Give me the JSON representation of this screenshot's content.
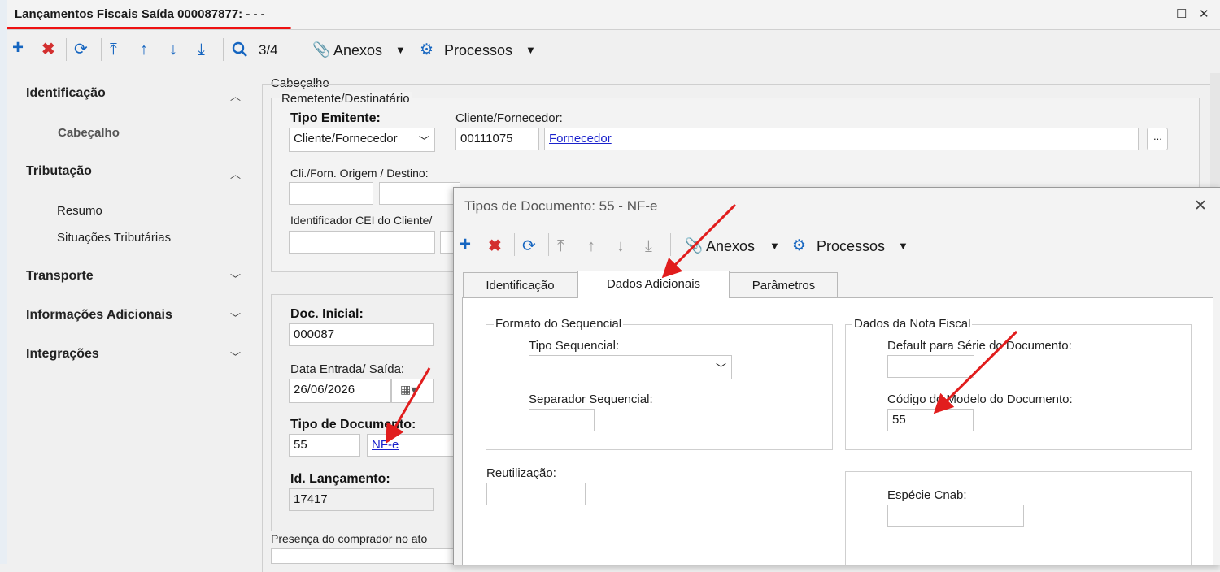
{
  "window": {
    "title": "Lançamentos Fiscais Saída 000087877:",
    "title_suffix": " - - -",
    "maximize_glyph": "☐",
    "close_glyph": "✕"
  },
  "toolbar": {
    "record_position": "3/4",
    "anexos_label": "Anexos",
    "processos_label": "Processos"
  },
  "sidebar": {
    "sections": [
      {
        "label": "Identificação",
        "expanded": true,
        "items": [
          "Cabeçalho"
        ]
      },
      {
        "label": "Tributação",
        "expanded": true,
        "items": [
          "Resumo",
          "Situações Tributárias"
        ]
      },
      {
        "label": "Transporte",
        "expanded": false,
        "items": []
      },
      {
        "label": "Informações Adicionais",
        "expanded": false,
        "items": []
      },
      {
        "label": "Integrações",
        "expanded": false,
        "items": []
      }
    ]
  },
  "form": {
    "cabecalho_label": "Cabeçalho",
    "remetente_label": "Remetente/Destinatário",
    "tipo_emitente_label": "Tipo Emitente:",
    "tipo_emitente_value": "Cliente/Fornecedor",
    "cliente_fornecedor_label": "Cliente/Fornecedor:",
    "cliente_code": "00111075",
    "cliente_link": "Fornecedor",
    "browse_label": "...",
    "origem_destino_label": "Cli./Forn. Origem / Destino:",
    "cei_label": "Identificador CEI do Cliente/",
    "doc_inicial_label": "Doc. Inicial:",
    "doc_inicial_value": "000087",
    "data_entrada_label": "Data Entrada/ Saída:",
    "data_entrada_value": "26/06/2026",
    "tipo_documento_label": "Tipo de Documento:",
    "tipo_documento_code": "55",
    "tipo_documento_link": "NF-e",
    "id_lancamento_label": "Id. Lançamento:",
    "id_lancamento_value": "17417",
    "presenca_label": "Presença do comprador no ato"
  },
  "dialog": {
    "title": "Tipos de Documento: 55 - NF-e",
    "toolbar": {
      "anexos_label": "Anexos",
      "processos_label": "Processos"
    },
    "tabs": [
      "Identificação",
      "Dados Adicionais",
      "Parâmetros"
    ],
    "active_tab": "Dados Adicionais",
    "formato_group": "Formato do Sequencial",
    "tipo_sequencial_label": "Tipo Sequencial:",
    "tipo_sequencial_value": "",
    "separador_label": "Separador Sequencial:",
    "separador_value": "",
    "reutilizacao_label": "Reutilização:",
    "reutilizacao_value": "",
    "nota_group": "Dados da Nota Fiscal",
    "default_serie_label": "Default para Série do Documento:",
    "default_serie_value": "",
    "codigo_modelo_label": "Código do Modelo do Documento:",
    "codigo_modelo_value": "55",
    "especie_label": "Espécie Cnab:",
    "especie_value": ""
  },
  "colors": {
    "accent": "#1565c0",
    "delete": "#d32f2f",
    "annotation": "#e11d1d",
    "link": "#1a22cc"
  }
}
